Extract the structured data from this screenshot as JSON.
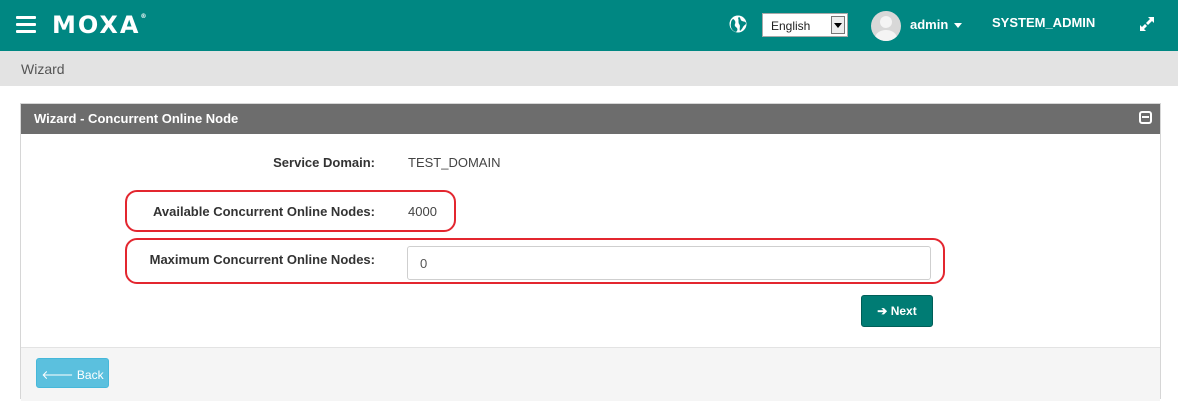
{
  "header": {
    "logo": "MOXA",
    "logo_mark": "®",
    "language": "English",
    "user": "admin",
    "role": "SYSTEM_ADMIN",
    "color": "#008782"
  },
  "breadcrumb": "Wizard",
  "panel": {
    "title": "Wizard - Concurrent Online Node",
    "service_domain": {
      "label": "Service Domain:",
      "value": "TEST_DOMAIN"
    },
    "available_nodes": {
      "label": "Available Concurrent Online Nodes:",
      "value": "4000"
    },
    "max_nodes": {
      "label": "Maximum Concurrent Online Nodes:",
      "value": "0"
    },
    "next_label": "Next",
    "back_label": "Back"
  },
  "icons": [
    "menu-icon",
    "globe-icon",
    "avatar",
    "chevron-down-icon",
    "expand-icon",
    "collapse-icon",
    "arrow-right-icon",
    "arrow-left-icon"
  ]
}
